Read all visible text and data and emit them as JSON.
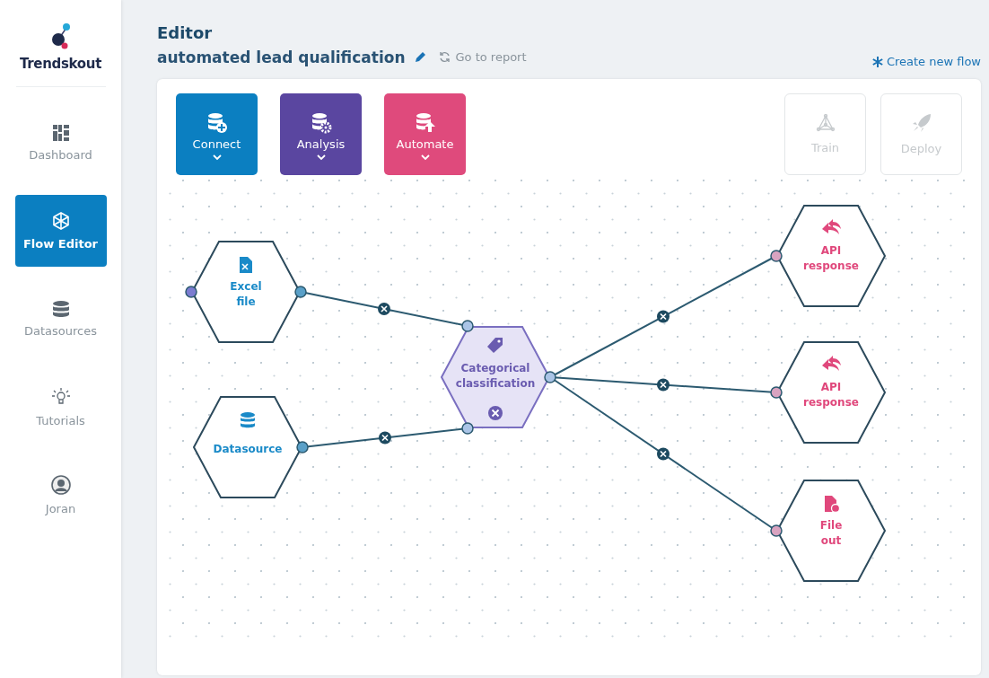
{
  "sidebar": {
    "logo": "Trendskout",
    "items": [
      {
        "label": "Dashboard",
        "selected": false
      },
      {
        "label": "Flow Editor",
        "selected": true
      },
      {
        "label": "Datasources",
        "selected": false
      },
      {
        "label": "Tutorials",
        "selected": false
      },
      {
        "label": "Joran",
        "selected": false
      }
    ]
  },
  "header": {
    "heading": "Editor",
    "flow_name": "automated lead qualification",
    "report_link": "Go to report",
    "create_link": "Create new flow"
  },
  "toolbar": {
    "categories": [
      {
        "label": "Connect",
        "kind": "connect"
      },
      {
        "label": "Analysis",
        "kind": "analysis"
      },
      {
        "label": "Automate",
        "kind": "automate"
      }
    ],
    "actions": [
      {
        "label": "Train",
        "disabled": true
      },
      {
        "label": "Deploy",
        "disabled": true
      }
    ]
  },
  "flow": {
    "nodes": [
      {
        "label": "Excel file",
        "kind": "source",
        "selected": false
      },
      {
        "label": "Datasource",
        "kind": "source",
        "selected": false
      },
      {
        "label": "Categorical classification",
        "kind": "analysis",
        "selected": true
      },
      {
        "label": "API response",
        "kind": "output",
        "selected": false
      },
      {
        "label": "API response",
        "kind": "output",
        "selected": false
      },
      {
        "label": "File out",
        "kind": "output",
        "selected": false
      }
    ]
  }
}
